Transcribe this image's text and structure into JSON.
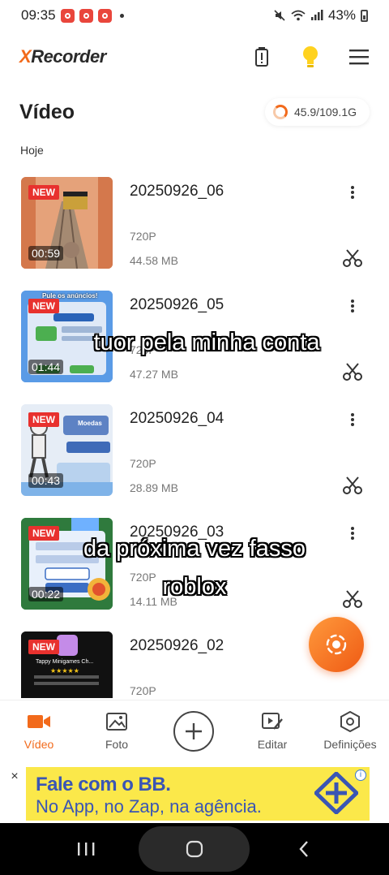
{
  "status_bar": {
    "time": "09:35",
    "battery": "43%"
  },
  "header": {
    "logo_prefix": "X",
    "logo_rest": "Recorder"
  },
  "title": "Vídeo",
  "storage": "45.9/109.1G",
  "section_date": "Hoje",
  "videos": [
    {
      "badge": "NEW",
      "title": "20250926_06",
      "duration": "00:59",
      "resolution": "720P",
      "size": "44.58 MB"
    },
    {
      "badge": "NEW",
      "title": "20250926_05",
      "duration": "01:44",
      "resolution": "720P",
      "size": "47.27 MB"
    },
    {
      "badge": "NEW",
      "title": "20250926_04",
      "duration": "00:43",
      "resolution": "720P",
      "size": "28.89 MB"
    },
    {
      "badge": "NEW",
      "title": "20250926_03",
      "duration": "00:22",
      "resolution": "720P",
      "size": "14.11 MB"
    },
    {
      "badge": "NEW",
      "title": "20250926_02",
      "duration": "",
      "resolution": "720P",
      "size": ""
    }
  ],
  "thumb_texts": {
    "t2_caption": "Pule os anúncios!",
    "t3_caption": "Moedas",
    "t5_caption": "Tappy Minigames Ch..."
  },
  "overlays": {
    "line1": "tuor pela minha conta",
    "line2": "da próxima vez fasso",
    "line3": "roblox"
  },
  "nav": [
    {
      "label": "Vídeo",
      "icon": "video-camera-icon",
      "active": true
    },
    {
      "label": "Foto",
      "icon": "image-icon",
      "active": false
    },
    {
      "label": "Editar",
      "icon": "edit-video-icon",
      "active": false
    },
    {
      "label": "Definições",
      "icon": "settings-hexagon-icon",
      "active": false
    }
  ],
  "ad": {
    "line1": "Fale com o BB.",
    "line2": "No App, no Zap, na agência.",
    "close": "×",
    "info": "i"
  },
  "colors": {
    "accent": "#f26a1b",
    "badge": "#e8312e",
    "ad_bg": "#fbe84a",
    "ad_text": "#3a55b4"
  }
}
